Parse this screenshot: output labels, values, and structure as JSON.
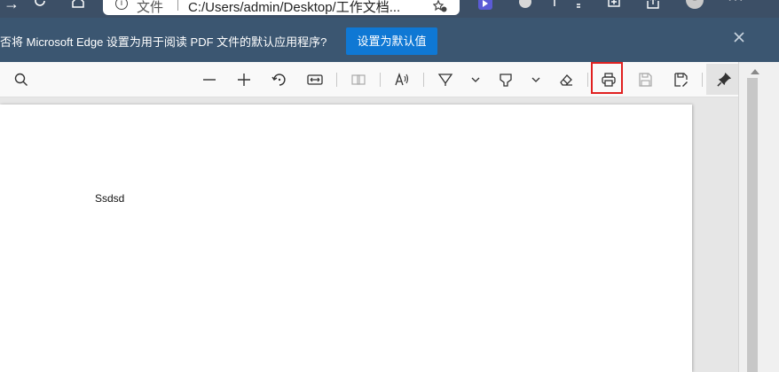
{
  "browser": {
    "address_label": "文件",
    "address_url": "C:/Users/admin/Desktop/工作文档..."
  },
  "banner": {
    "message": "否将 Microsoft Edge 设置为用于阅读 PDF 文件的默认应用程序?",
    "set_default_label": "设置为默认值"
  },
  "toolbar": {
    "icons": [
      "search-icon",
      "zoom-out-icon",
      "zoom-in-icon",
      "rotate-icon",
      "fit-width-icon",
      "page-view-icon",
      "read-aloud-icon",
      "draw-icon",
      "chevron-down-icon",
      "highlight-icon",
      "chevron-down-icon",
      "eraser-icon",
      "print-icon",
      "save-icon",
      "save-as-icon",
      "pin-icon"
    ],
    "highlight_color": "#e02020"
  },
  "document": {
    "text": "Ssdsd"
  },
  "colors": {
    "topbar": "#3c4f66",
    "banner": "#3b5671",
    "button": "#0f78d4"
  }
}
